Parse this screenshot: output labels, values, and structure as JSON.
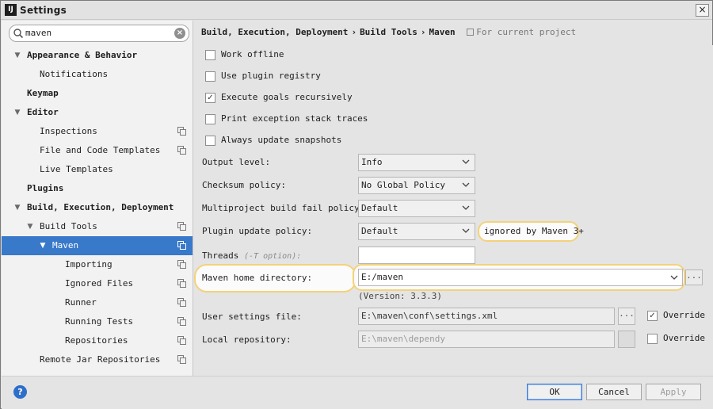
{
  "window": {
    "app_icon_text": "IJ",
    "title": "Settings",
    "close_label": "×"
  },
  "search": {
    "value": "maven"
  },
  "tree": [
    {
      "label": "Appearance & Behavior",
      "level": 0,
      "bold": true,
      "arrow": "down"
    },
    {
      "label": "Notifications",
      "level": 1
    },
    {
      "label": "Keymap",
      "level": 0,
      "bold": true
    },
    {
      "label": "Editor",
      "level": 0,
      "bold": true,
      "arrow": "down"
    },
    {
      "label": "Inspections",
      "level": 1,
      "project_icon": true
    },
    {
      "label": "File and Code Templates",
      "level": 1,
      "project_icon": true
    },
    {
      "label": "Live Templates",
      "level": 1
    },
    {
      "label": "Plugins",
      "level": 0,
      "bold": true
    },
    {
      "label": "Build, Execution, Deployment",
      "level": 0,
      "bold": true,
      "arrow": "down"
    },
    {
      "label": "Build Tools",
      "level": 1,
      "arrow": "down",
      "project_icon": true
    },
    {
      "label": "Maven",
      "level": 2,
      "arrow": "down",
      "selected": true,
      "project_icon": true
    },
    {
      "label": "Importing",
      "level": 3,
      "project_icon": true
    },
    {
      "label": "Ignored Files",
      "level": 3,
      "project_icon": true
    },
    {
      "label": "Runner",
      "level": 3,
      "project_icon": true
    },
    {
      "label": "Running Tests",
      "level": 3,
      "project_icon": true
    },
    {
      "label": "Repositories",
      "level": 3,
      "project_icon": true
    },
    {
      "label": "Remote Jar Repositories",
      "level": 1,
      "project_icon": true
    }
  ],
  "breadcrumb": {
    "segments": [
      "Build, Execution, Deployment",
      "Build Tools",
      "Maven"
    ],
    "separator": "›",
    "scope": "For current project"
  },
  "checkboxes": [
    {
      "label": "Work offline",
      "checked": false
    },
    {
      "label": "Use plugin registry",
      "checked": false
    },
    {
      "label": "Execute goals recursively",
      "checked": true
    },
    {
      "label": "Print exception stack traces",
      "checked": false
    },
    {
      "label": "Always update snapshots",
      "checked": false
    }
  ],
  "output_level": {
    "label": "Output level:",
    "value": "Info"
  },
  "checksum_policy": {
    "label": "Checksum policy:",
    "value": "No Global Policy"
  },
  "multiproject_policy": {
    "label": "Multiproject build fail policy:",
    "value": "Default"
  },
  "plugin_update_policy": {
    "label": "Plugin update policy:",
    "value": "Default",
    "note": "ignored by Maven 3+"
  },
  "threads": {
    "label": "Threads",
    "hint": "(-T option):",
    "value": ""
  },
  "maven_home": {
    "label": "Maven home directory:",
    "value": "E:/maven",
    "browse": "...",
    "version": "(Version: 3.3.3)"
  },
  "user_settings": {
    "label": "User settings file:",
    "value": "E:\\maven\\conf\\settings.xml",
    "browse": "...",
    "override_label": "Override",
    "override_checked": true
  },
  "local_repo": {
    "label": "Local repository:",
    "value": "E:\\maven\\dependy",
    "browse": "",
    "override_label": "Override",
    "override_checked": false
  },
  "buttons": {
    "ok": "OK",
    "cancel": "Cancel",
    "apply": "Apply"
  },
  "colors": {
    "selection": "#3879c9",
    "highlight": "#f4d27a",
    "help": "#2d6fca"
  }
}
